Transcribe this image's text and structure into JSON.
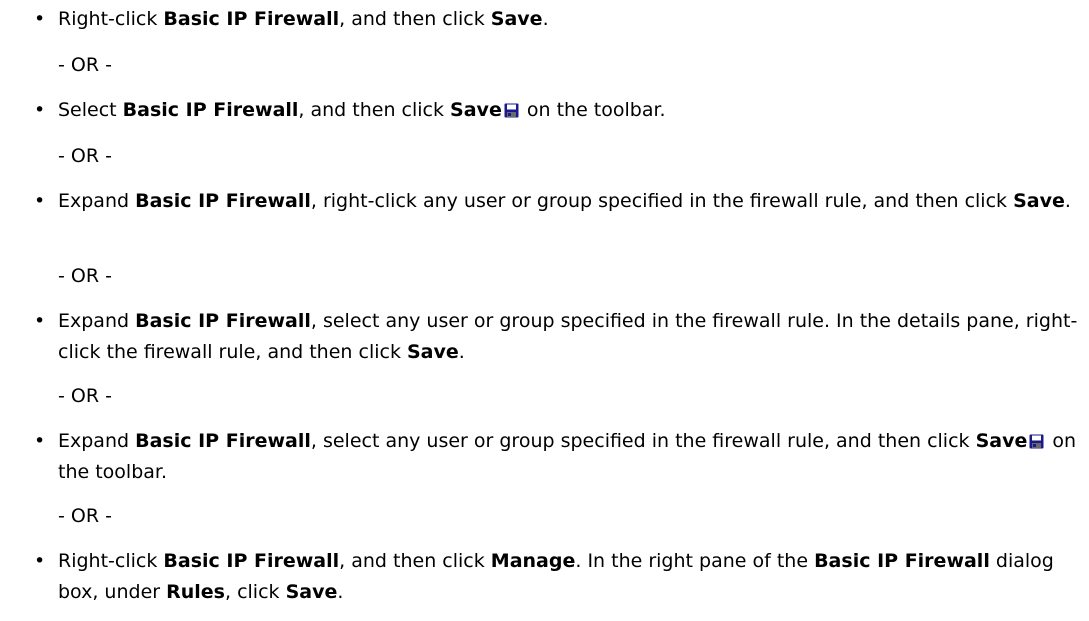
{
  "bullet_glyph": "•",
  "or_separator": "- OR -",
  "steps": [
    {
      "part1": "Right-click ",
      "bold1": "Basic IP Firewall",
      "part2": ", and then click ",
      "bold2": "Save",
      "part3": "."
    },
    {
      "part1": "Select ",
      "bold1": "Basic IP Firewall",
      "part2": ", and then click ",
      "bold2": "Save",
      "part3": " on the toolbar.",
      "icon": "floppy-disk-save-icon"
    },
    {
      "part1": "Expand ",
      "bold1": "Basic IP Firewall",
      "part2": ", right-click any user or group specified in the firewall rule, and then click ",
      "bold2": "Save",
      "part3": "."
    },
    {
      "part1": "Expand ",
      "bold1": "Basic IP Firewall",
      "part2": ", select any user or group specified in the firewall rule. In the details pane, right-click the firewall rule, and then click ",
      "bold2": "Save",
      "part3": "."
    },
    {
      "part1": "Expand ",
      "bold1": "Basic IP Firewall",
      "part2": ", select any user or group specified in the firewall rule, and then click ",
      "bold2": "Save",
      "part3": " on the toolbar.",
      "icon": "floppy-disk-save-icon"
    },
    {
      "part1": "Right-click ",
      "bold1": "Basic IP Firewall",
      "part2": ", and then click ",
      "bold2": "Manage",
      "part3": ". In the right pane of the ",
      "bold3": "Basic IP Firewall",
      "part4": " dialog box, under ",
      "bold4": "Rules",
      "part5": ", click ",
      "bold5": "Save",
      "part6": "."
    }
  ],
  "colors": {
    "text": "#000000",
    "icon_body": "#1a1a8c",
    "icon_label": "#ffffff"
  }
}
